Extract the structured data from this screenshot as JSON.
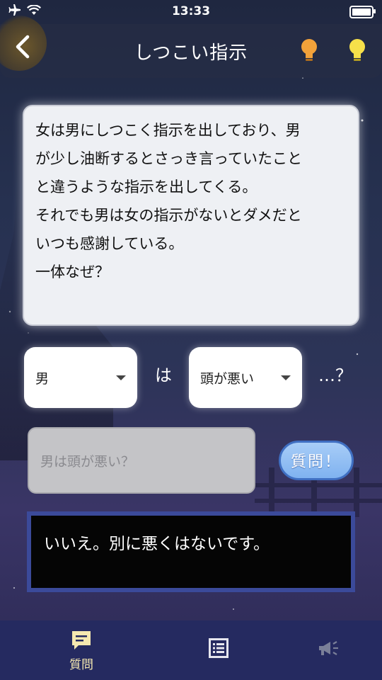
{
  "status_bar": {
    "time": "13:33",
    "battery_level": 0.85
  },
  "header": {
    "title": "しつこい指示"
  },
  "question": {
    "lines": [
      "女は男にしつこく指示を出しており、男",
      "が少し油断するとさっき言っていたこと",
      "と違うような指示を出してくる。",
      "それでも男は女の指示がないとダメだと",
      "いつも感謝している。",
      "一体なぜ？"
    ]
  },
  "builder": {
    "subject_value": "男",
    "particle": "は",
    "predicate_value": "頭が悪い",
    "suffix": "…？",
    "composed_text": "男は頭が悪い？",
    "ask_label": "質問！"
  },
  "answer": {
    "text": "いいえ。別に悪くはないです。"
  },
  "tabs": [
    {
      "label": "質問",
      "icon": "speech-bubble-icon",
      "active": true
    },
    {
      "label": "",
      "icon": "list-icon",
      "active": false
    },
    {
      "label": "",
      "icon": "megaphone-icon",
      "active": false
    }
  ],
  "colors": {
    "accent": "#7fb2f0",
    "tab_bar": "#252a60",
    "answer_border": "#3b4a9a",
    "active_tab": "#f5e8b0",
    "inactive_tab": "#7a7f98"
  }
}
